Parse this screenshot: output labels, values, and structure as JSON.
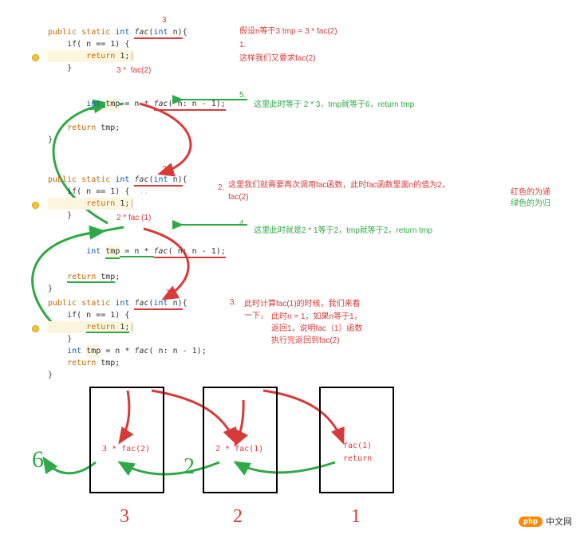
{
  "params": {
    "p1": "3",
    "p2": "2",
    "p3": "1"
  },
  "code_line": {
    "sig_a": "public",
    "sig_b": "static",
    "sig_c": "int",
    "sig_d": "fac",
    "sig_e": "int",
    "sig_f": "n",
    "ifcond": "if( n == 1) {",
    "ret1": "return 1;",
    "closebrace": "}",
    "tmp_a": "int",
    "tmp_b": "tmp",
    "tmp_c": " = n * ",
    "tmp_d": "fac",
    "tmp_e": "( n: n - 1);",
    "rettmp": "return tmp;",
    "end": "}"
  },
  "inline_expr": {
    "e1": "3 *  fac(2)",
    "e2": "2 * fac (1)"
  },
  "notes": {
    "premise": "假设n等于3    tmp = 3 * fac(2)",
    "n1": "这样我们又要求fac(2)",
    "s1_num": "1.",
    "s5_num": "5.",
    "s5": "这里此时等于 2 * 3，tmp就等于6，return tmp",
    "s2_num": "2.",
    "s2": "这里我们就需要再次调用fac函数，此时fac函数里面n的值为2，fac(2)",
    "s4_num": "4.",
    "s4": "这里此时就是2 * 1等于2，tmp就等于2，return tmp",
    "s3_num": "3.",
    "s3a": "此时计算fac(1)的时候，我们来看一下，",
    "s3b": "此时n = 1，如果n等于1，返回1，说明fac（1）函数执行完返回到fac(2)",
    "legend_red": "红色的为递",
    "legend_green": "绿色的为归"
  },
  "stack": {
    "box1": "3 * fac(2)",
    "box2": "2 * fac(1)",
    "box3a": "fac(1)",
    "box3b": "return",
    "num6": "6",
    "num2": "2",
    "bottom1": "3",
    "bottom2": "2",
    "bottom3": "1"
  },
  "logo": {
    "pill": "php",
    "text": "中文网"
  }
}
